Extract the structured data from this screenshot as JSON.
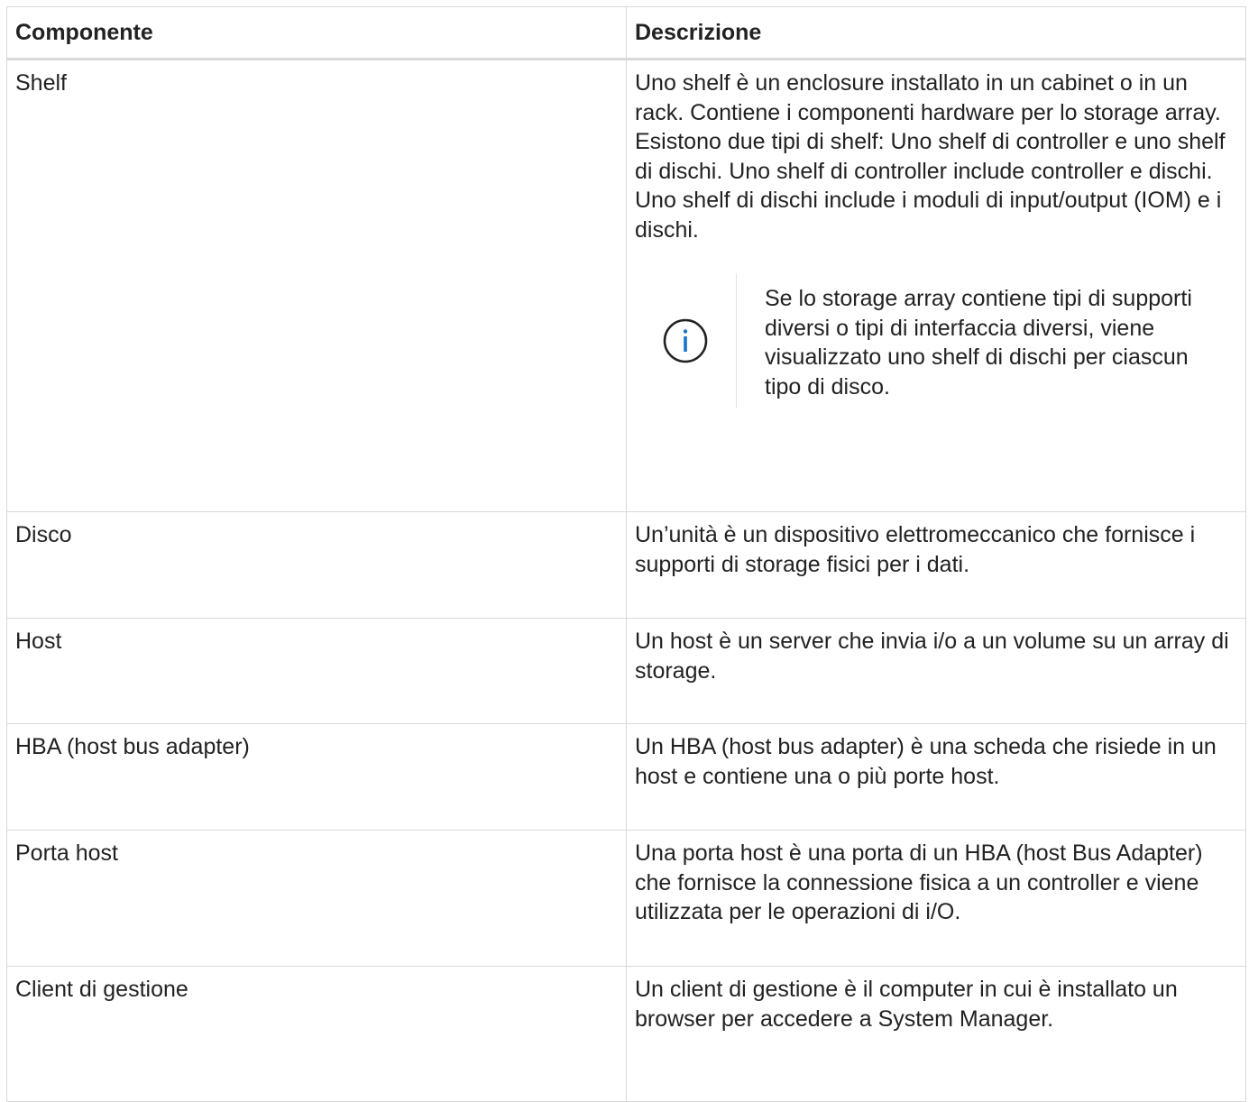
{
  "table": {
    "headers": [
      "Componente",
      "Descrizione"
    ],
    "rows": [
      {
        "component": "Shelf",
        "description": "Uno shelf è un enclosure installato in un cabinet o in un rack. Contiene i componenti hardware per lo storage array. Esistono due tipi di shelf: Uno shelf di controller e uno shelf di dischi. Uno shelf di controller include controller e dischi. Uno shelf di dischi include i moduli di input/output (IOM) e i dischi.",
        "note": "Se lo storage array contiene tipi di supporti diversi o tipi di interfaccia diversi, viene visualizzato uno shelf di dischi per ciascun tipo di disco."
      },
      {
        "component": "Disco",
        "description": "Un’unità è un dispositivo elettromeccanico che fornisce i supporti di storage fisici per i dati."
      },
      {
        "component": "Host",
        "description": "Un host è un server che invia i/o a un volume su un array di storage."
      },
      {
        "component": "HBA (host bus adapter)",
        "description": "Un HBA (host bus adapter) è una scheda che risiede in un host e contiene una o più porte host."
      },
      {
        "component": "Porta host",
        "description": "Una porta host è una porta di un HBA (host Bus Adapter) che fornisce la connessione fisica a un controller e viene utilizzata per le operazioni di i/O."
      },
      {
        "component": "Client di gestione",
        "description": "Un client di gestione è il computer in cui è installato un browser per accedere a System Manager."
      }
    ]
  },
  "icons": {
    "note_icon": "info-circle-icon",
    "note_icon_color": "#1a73c9"
  }
}
